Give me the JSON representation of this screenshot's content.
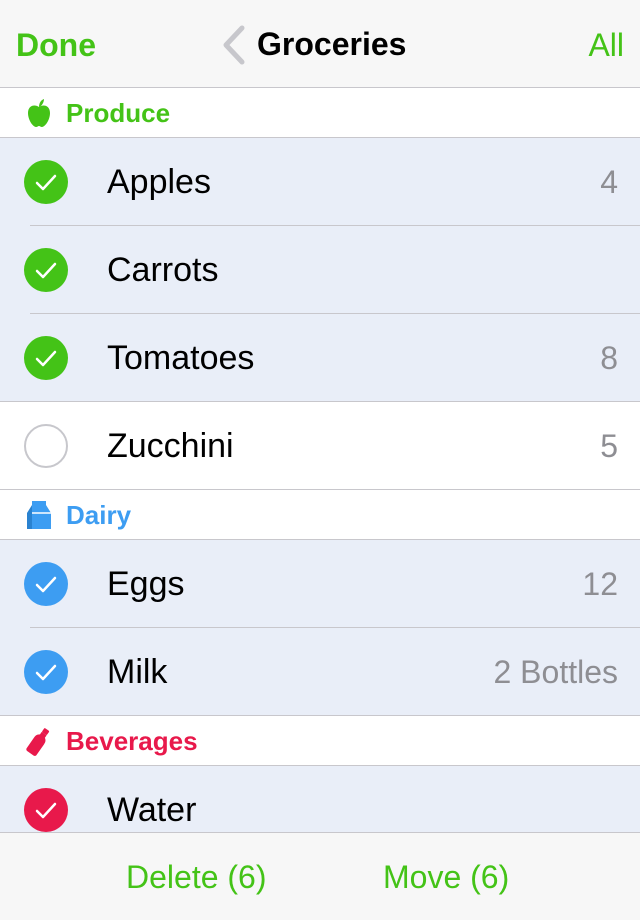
{
  "nav": {
    "done_label": "Done",
    "title": "Groceries",
    "all_label": "All"
  },
  "colors": {
    "green": "#44c317",
    "blue": "#3d9df2",
    "red": "#e8194b",
    "row_checked_bg": "#e9eef8"
  },
  "sections": [
    {
      "label": "Produce",
      "icon": "apple-icon",
      "items": [
        {
          "name": "Apples",
          "qty": "4",
          "checked": true
        },
        {
          "name": "Carrots",
          "qty": "",
          "checked": true
        },
        {
          "name": "Tomatoes",
          "qty": "8",
          "checked": true
        },
        {
          "name": "Zucchini",
          "qty": "5",
          "checked": false
        }
      ]
    },
    {
      "label": "Dairy",
      "icon": "milk-carton-icon",
      "items": [
        {
          "name": "Eggs",
          "qty": "12",
          "checked": true
        },
        {
          "name": "Milk",
          "qty": "2 Bottles",
          "checked": true
        }
      ]
    },
    {
      "label": "Beverages",
      "icon": "bottle-icon",
      "items": [
        {
          "name": "Water",
          "qty": "",
          "checked": true
        }
      ]
    }
  ],
  "toolbar": {
    "delete_label": "Delete (6)",
    "move_label": "Move (6)"
  }
}
